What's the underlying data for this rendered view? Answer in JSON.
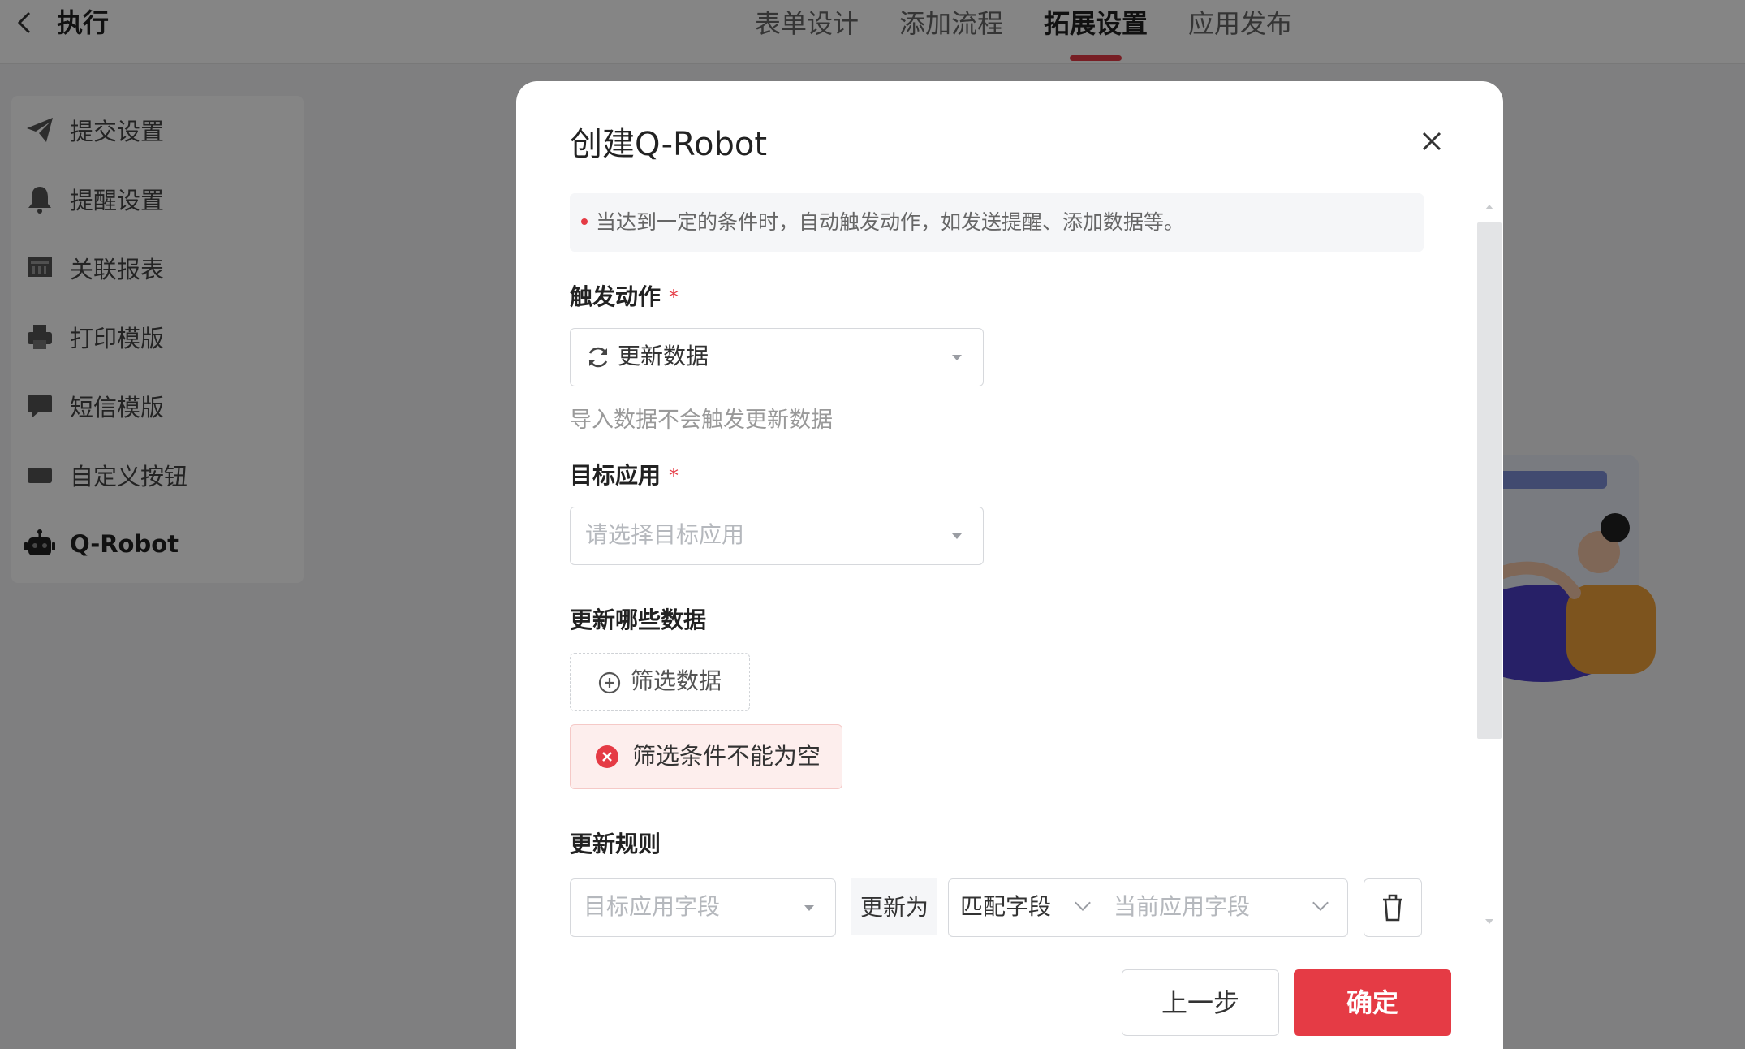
{
  "header": {
    "back_icon": "chevron-left-icon",
    "title": "执行",
    "tabs": [
      {
        "label": "表单设计",
        "active": false
      },
      {
        "label": "添加流程",
        "active": false
      },
      {
        "label": "拓展设置",
        "active": true
      },
      {
        "label": "应用发布",
        "active": false
      }
    ]
  },
  "sidebar": {
    "items": [
      {
        "label": "提交设置",
        "icon": "paper-plane-icon"
      },
      {
        "label": "提醒设置",
        "icon": "bell-icon"
      },
      {
        "label": "关联报表",
        "icon": "report-icon"
      },
      {
        "label": "打印模版",
        "icon": "printer-icon"
      },
      {
        "label": "短信模版",
        "icon": "message-icon"
      },
      {
        "label": "自定义按钮",
        "icon": "custom-button-icon"
      },
      {
        "label": "Q-Robot",
        "icon": "robot-icon",
        "active": true
      }
    ]
  },
  "modal": {
    "title": "创建Q-Robot",
    "close_icon": "close-icon",
    "notice": "当达到一定的条件时，自动触发动作，如发送提醒、添加数据等。",
    "trigger": {
      "label": "触发动作",
      "required_mark": "*",
      "value": "更新数据",
      "icon": "refresh-icon",
      "hint": "导入数据不会触发更新数据"
    },
    "target_app": {
      "label": "目标应用",
      "required_mark": "*",
      "placeholder": "请选择目标应用"
    },
    "update_data": {
      "label": "更新哪些数据",
      "filter_button": "筛选数据",
      "error": "筛选条件不能为空"
    },
    "update_rule": {
      "label": "更新规则",
      "target_field_placeholder": "目标应用字段",
      "update_to": "更新为",
      "match_field": "匹配字段",
      "current_field_placeholder": "当前应用字段",
      "delete_icon": "trash-icon"
    },
    "buttons": {
      "prev": "上一步",
      "confirm": "确定"
    }
  },
  "colors": {
    "accent": "#e53b45",
    "overlay": "rgba(0,0,0,0.48)",
    "error_bg": "#fdeeed"
  }
}
